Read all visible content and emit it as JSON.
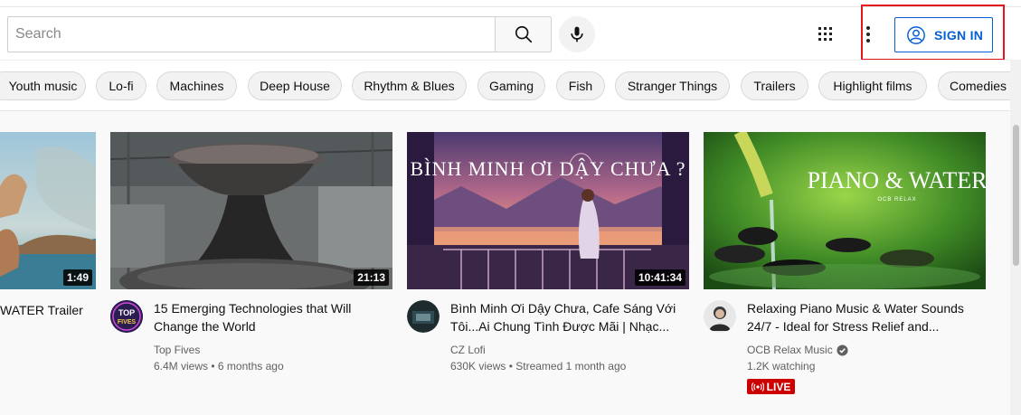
{
  "header": {
    "search_placeholder": "Search",
    "sign_in_label": "SIGN IN"
  },
  "chips": [
    {
      "label": "Youth music"
    },
    {
      "label": "Lo-fi"
    },
    {
      "label": "Machines"
    },
    {
      "label": "Deep House"
    },
    {
      "label": "Rhythm & Blues"
    },
    {
      "label": "Gaming"
    },
    {
      "label": "Fish"
    },
    {
      "label": "Stranger Things"
    },
    {
      "label": "Trailers"
    },
    {
      "label": "Highlight films"
    },
    {
      "label": "Comedies"
    }
  ],
  "videos": [
    {
      "title": "WATER Trailer",
      "duration": "1:49"
    },
    {
      "title_line1": "15 Emerging Technologies that Will",
      "title_line2": "Change the World",
      "channel": "Top Fives",
      "views": "6.4M views",
      "age": "6 months ago",
      "duration": "21:13",
      "avatar_text": "TOP FIVES"
    },
    {
      "title_line1": "Bình Minh Ơi Dậy Chưa, Cafe Sáng Với",
      "title_line2": "Tôi...Ai Chung Tình Được Mãi | Nhạc...",
      "thumb_text": "BÌNH MINH ƠI DẬY CHƯA ?",
      "channel": "CZ Lofi",
      "views": "630K views",
      "age": "Streamed 1 month ago",
      "duration": "10:41:34"
    },
    {
      "title_line1": "Relaxing Piano Music & Water Sounds",
      "title_line2": "24/7 - Ideal for Stress Relief and...",
      "thumb_text": "PIANO & WATER",
      "thumb_subtext": "OCB RELAX",
      "channel": "OCB Relax Music",
      "views": "1.2K watching",
      "badge": "LIVE"
    }
  ],
  "colors": {
    "accent": "#065fd4",
    "highlight": "#e4161b",
    "live": "#cc0000"
  }
}
